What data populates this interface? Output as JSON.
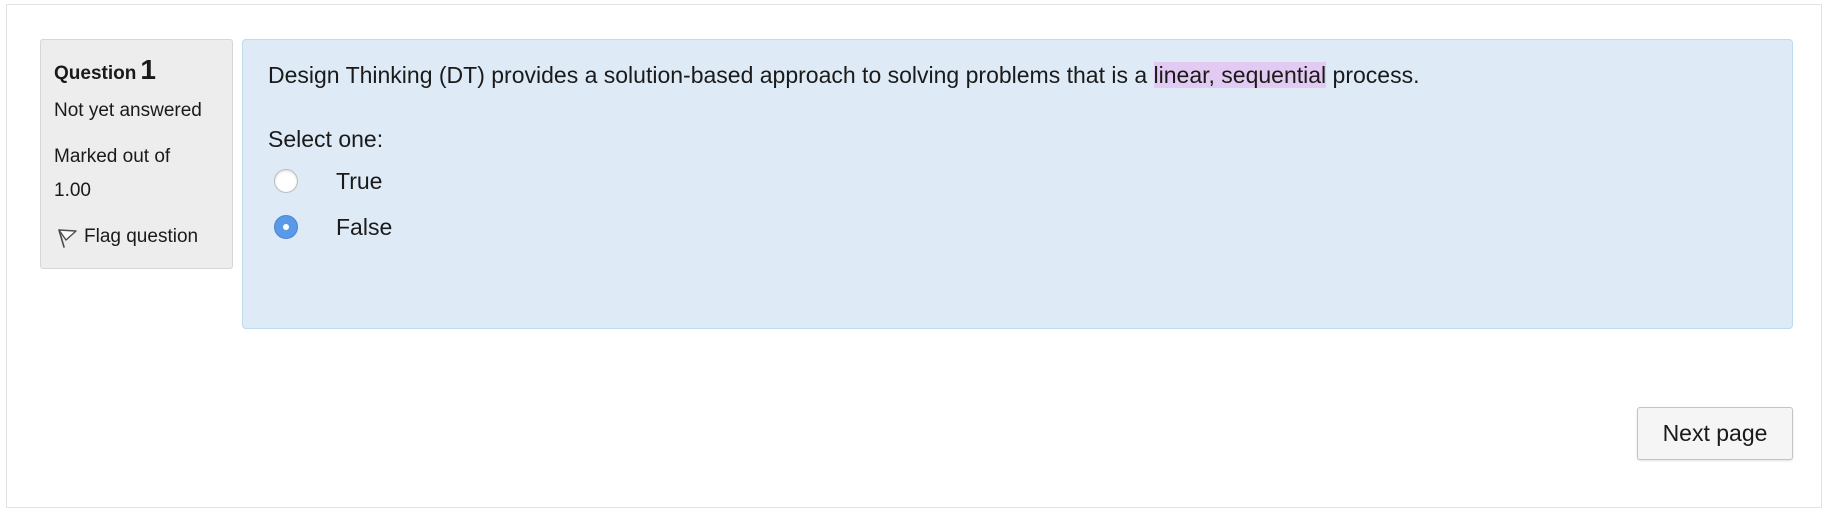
{
  "question_info": {
    "label": "Question",
    "number": "1",
    "state": "Not yet answered",
    "marked_out_of_label": "Marked out of",
    "marked_out_of_value": "1.00",
    "flag_label": "Flag question",
    "flag_icon": "flag-icon"
  },
  "question": {
    "text_before": "Design Thinking (DT) provides a solution-based approach to solving problems that is a ",
    "text_highlight": "linear, sequential",
    "text_after": " process.",
    "highlight_color": "#e3caf2",
    "prompt": "Select one:",
    "options": [
      {
        "label": "True",
        "selected": false
      },
      {
        "label": "False",
        "selected": true
      }
    ]
  },
  "navigation": {
    "next_label": "Next page"
  },
  "colors": {
    "formulation_bg": "#deeaf6",
    "info_bg": "#ededed",
    "radio_selected": "#5a98e8"
  }
}
